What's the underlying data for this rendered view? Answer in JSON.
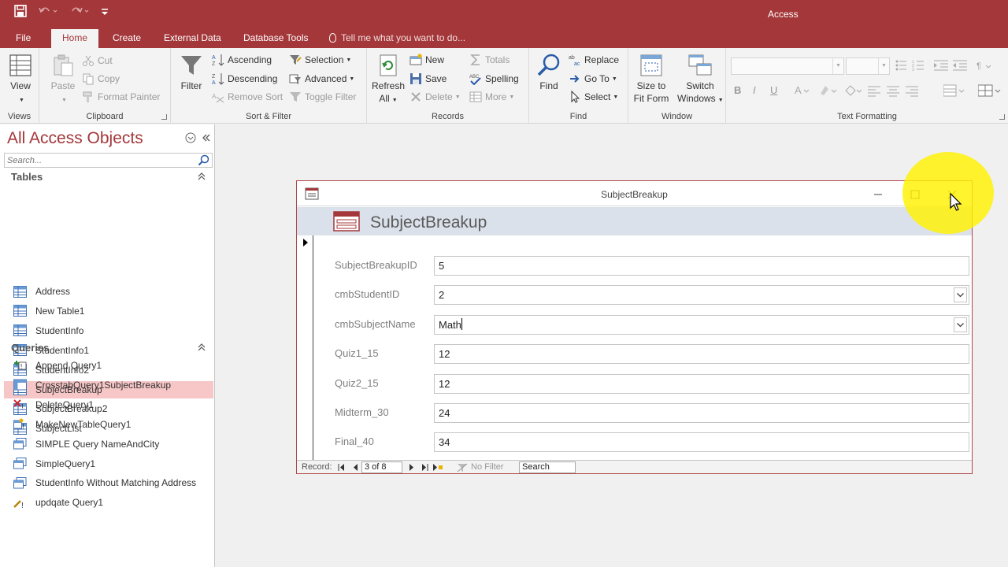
{
  "app": {
    "title": "Access"
  },
  "tabs": [
    "File",
    "Home",
    "Create",
    "External Data",
    "Database Tools"
  ],
  "tell_me": "Tell me what you want to do...",
  "ribbon": {
    "views": {
      "view": "View",
      "label": "Views"
    },
    "clipboard": {
      "paste": "Paste",
      "cut": "Cut",
      "copy": "Copy",
      "format_painter": "Format Painter",
      "label": "Clipboard"
    },
    "sort_filter": {
      "filter": "Filter",
      "ascending": "Ascending",
      "descending": "Descending",
      "remove_sort": "Remove Sort",
      "selection": "Selection",
      "advanced": "Advanced",
      "toggle_filter": "Toggle Filter",
      "label": "Sort & Filter"
    },
    "records": {
      "refresh_1": "Refresh",
      "refresh_2": "All",
      "new": "New",
      "save": "Save",
      "delete": "Delete",
      "totals": "Totals",
      "spelling": "Spelling",
      "more": "More",
      "label": "Records"
    },
    "find": {
      "find": "Find",
      "replace": "Replace",
      "goto": "Go To",
      "select": "Select",
      "label": "Find"
    },
    "window": {
      "size_1": "Size to",
      "size_2": "Fit Form",
      "switch_1": "Switch",
      "switch_2": "Windows",
      "label": "Window"
    },
    "text_formatting": {
      "bold": "B",
      "italic": "I",
      "underline": "U",
      "label": "Text Formatting"
    }
  },
  "nav": {
    "title": "All Access Objects",
    "search_placeholder": "Search...",
    "tables_header": "Tables",
    "tables": [
      "Address",
      "New Table1",
      "StudentInfo",
      "StudentInfo1",
      "StudentInfo2",
      "SubjectBreakup",
      "SubjectBreakup2",
      "SubjectList"
    ],
    "queries_header": "Queries",
    "queries": [
      "Append Query1",
      "CrosstabQuery1SubjectBreakup",
      "DeleteQuery1",
      "MakeNewTableQuery1",
      "SIMPLE Query NameAndCity",
      "SimpleQuery1",
      "StudentInfo Without Matching Address",
      "updqate Query1"
    ]
  },
  "form": {
    "window_title": "SubjectBreakup",
    "header": "SubjectBreakup",
    "fields": [
      {
        "label": "SubjectBreakupID",
        "value": "5"
      },
      {
        "label": "cmbStudentID",
        "value": "2"
      },
      {
        "label": "cmbSubjectName",
        "value": "Math"
      },
      {
        "label": "Quiz1_15",
        "value": "12"
      },
      {
        "label": "Quiz2_15",
        "value": "12"
      },
      {
        "label": "Midterm_30",
        "value": "24"
      },
      {
        "label": "Final_40",
        "value": "34"
      }
    ],
    "record_nav": {
      "label": "Record:",
      "position": "3 of 8",
      "filter": "No Filter",
      "search": "Search"
    }
  },
  "colors": {
    "accent": "#a4373a",
    "selected_item": "#f7c6c7",
    "form_header": "#dbe1ea",
    "highlight": "#fff200"
  }
}
